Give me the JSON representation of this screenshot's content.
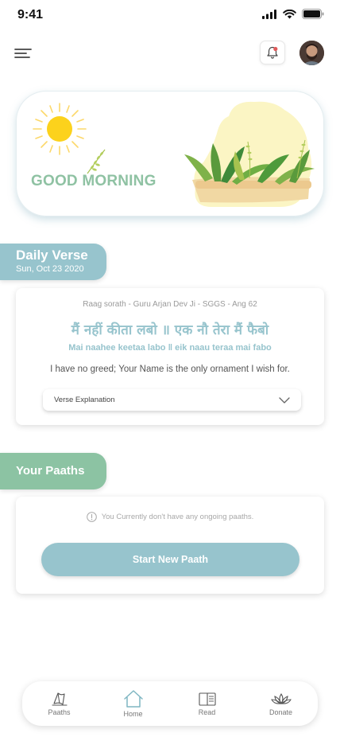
{
  "status_bar": {
    "time": "9:41",
    "icons": [
      "cellular-signal-icon",
      "wifi-icon",
      "battery-icon"
    ]
  },
  "header": {
    "menu_icon": "hamburger-menu-icon",
    "notification_icon": "bell-icon",
    "notification_badge_color": "#e05a5a"
  },
  "greeting": {
    "text": "GOOD MORNING",
    "sun_color": "#fcd21c",
    "blob_color": "#fbf5c4"
  },
  "daily_verse": {
    "section_title": "Daily Verse",
    "date": "Sun, Oct 23 2020",
    "source": "Raag sorath - Guru Arjan Dev Ji - SGGS - Ang 62",
    "verse_hindi": "मैं नहीं कीता लबो ॥ एक नौ तेरा मैं फैबो",
    "verse_transliteration": "Mai naahee keetaa labo ‖ eik naau teraa mai fabo",
    "translation": "I have no greed; Your Name is the only ornament I wish for.",
    "explanation_dropdown": "Verse Explanation"
  },
  "paaths": {
    "section_title": "Your Paaths",
    "empty_message": "You Currently don't have any ongoing paaths.",
    "start_button": "Start New Paath"
  },
  "bottom_nav": {
    "items": [
      {
        "label": "Paaths",
        "icon": "book-stand-icon"
      },
      {
        "label": "Home",
        "icon": "home-icon",
        "active": true
      },
      {
        "label": "Read",
        "icon": "open-book-icon"
      },
      {
        "label": "Donate",
        "icon": "lotus-icon"
      }
    ]
  },
  "colors": {
    "accent_blue": "#97c4cd",
    "accent_green": "#8cc3a3"
  }
}
